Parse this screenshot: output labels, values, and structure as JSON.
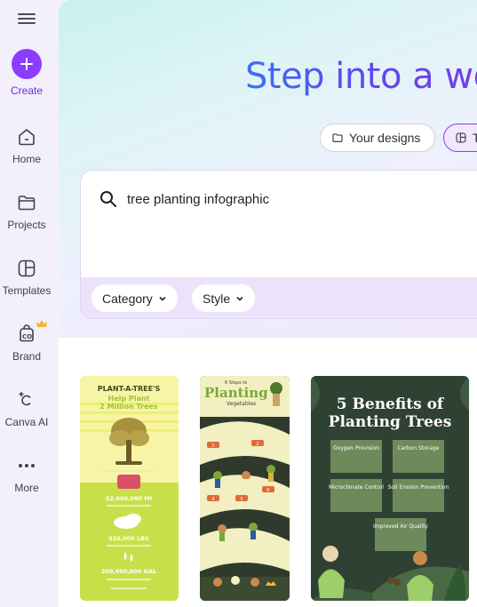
{
  "sidebar": {
    "create_label": "Create",
    "items": [
      {
        "label": "Home",
        "icon": "home-icon"
      },
      {
        "label": "Projects",
        "icon": "folder-icon"
      },
      {
        "label": "Templates",
        "icon": "templates-icon"
      },
      {
        "label": "Brand",
        "icon": "brand-icon"
      },
      {
        "label": "Canva AI",
        "icon": "canva-ai-icon"
      },
      {
        "label": "More",
        "icon": "more-icon"
      }
    ]
  },
  "hero": {
    "headline": "Step into a wo",
    "tabs": [
      {
        "label": "Your designs",
        "icon": "folder-icon"
      },
      {
        "label": "T",
        "icon": "templates-icon"
      }
    ]
  },
  "search": {
    "value": "tree planting infographic",
    "filters": [
      "Category",
      "Style"
    ]
  },
  "results": [
    {
      "title_line1": "PLANT-A-TREE'S",
      "title_line2": "Help Plant",
      "title_line3": "2 Million Trees",
      "stat1": "52,000,000 MI",
      "stat2": "520,000 LBS",
      "stat3": "200,000,000 GAL"
    },
    {
      "title_small": "6 Steps to",
      "title_big": "Planting",
      "title_sub": "Vegetables",
      "step_label": "Step",
      "step_numbers": [
        "1",
        "2",
        "3",
        "4",
        "5",
        "6"
      ]
    },
    {
      "title_line1": "5 Benefits of",
      "title_line2": "Planting Trees",
      "benefits": [
        "Oxygen Provision",
        "Carbon Storage",
        "Microclimate Control",
        "Soil Erosion Prevention",
        "Improved Air Quality"
      ]
    }
  ],
  "colors": {
    "accent": "#8b3dff",
    "card1_bg": "#c7e04a",
    "card3_bg": "#2f4133"
  }
}
